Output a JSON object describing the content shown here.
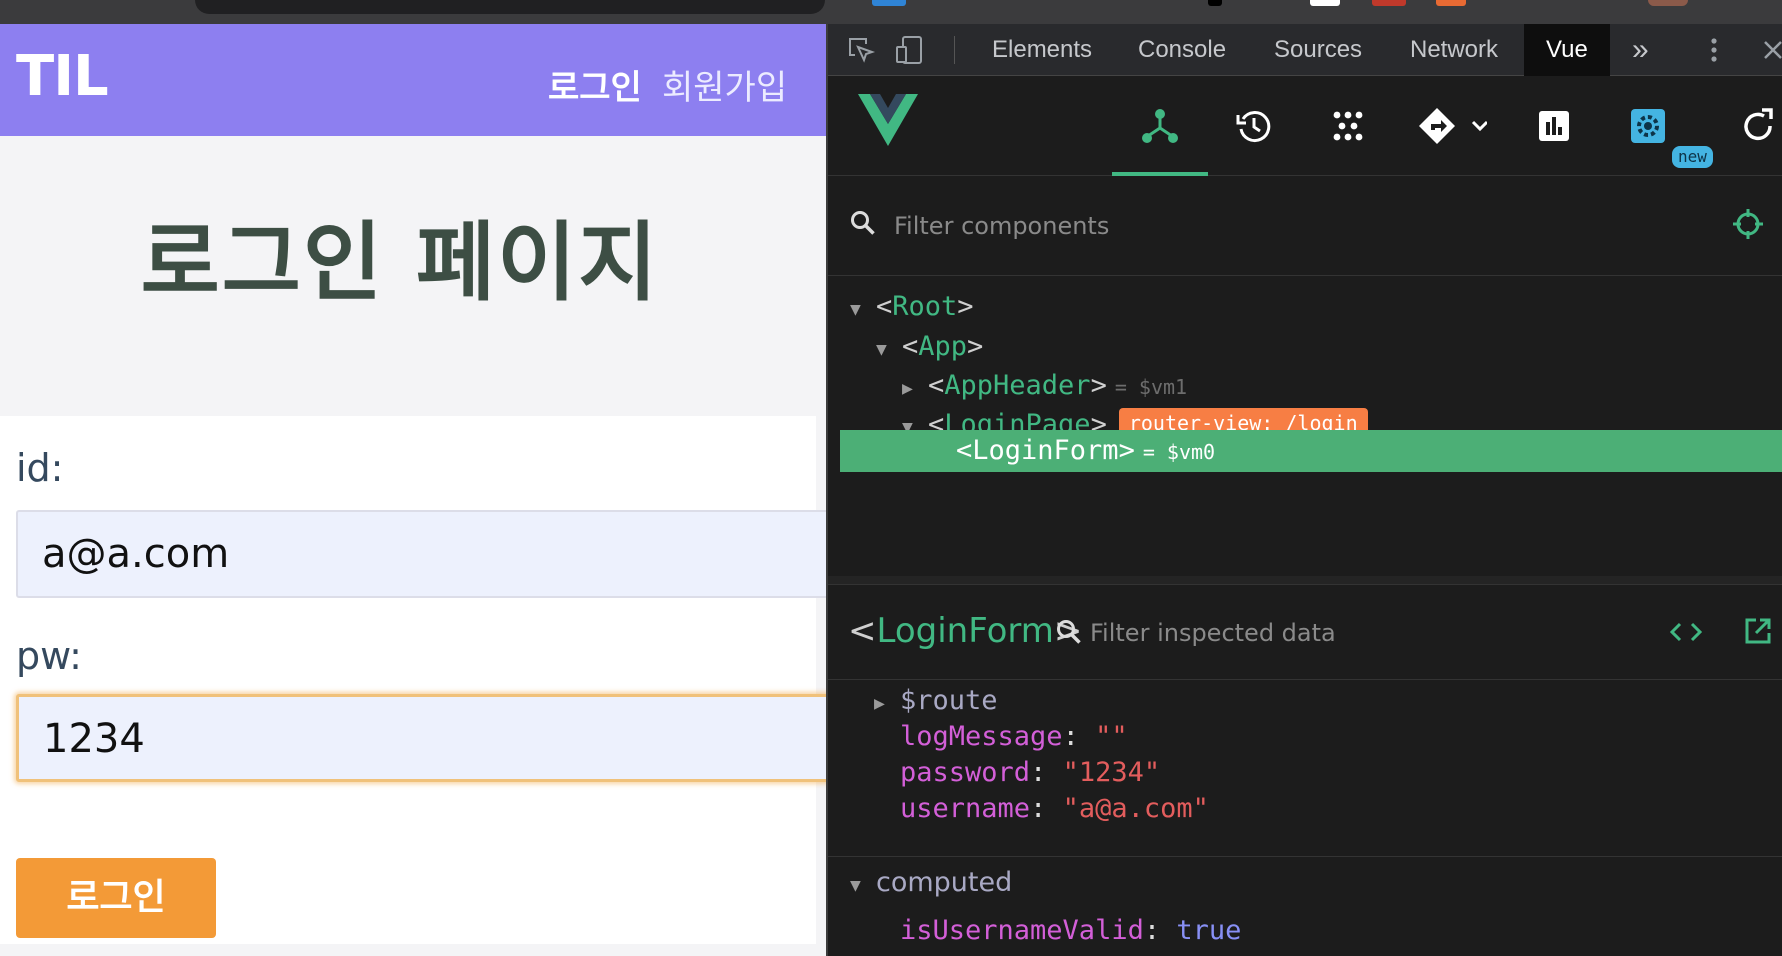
{
  "app": {
    "logo": "TIL",
    "nav": {
      "login": "로그인",
      "signup": "회원가입"
    },
    "page_title": "로그인 페이지",
    "form": {
      "id_label": "id:",
      "id_value": "a@a.com",
      "pw_label": "pw:",
      "pw_value": "1234",
      "submit_label": "로그인"
    }
  },
  "devtools": {
    "tabs": [
      "Elements",
      "Console",
      "Sources",
      "Network",
      "Vue"
    ],
    "active_tab": "Vue",
    "more_tabs": "»",
    "toolbar_badge": "new",
    "filter_placeholder": "Filter components",
    "tree": {
      "root": "Root",
      "app": "App",
      "app_header": "AppHeader",
      "app_header_ref": "= $vm1",
      "login_page": "LoginPage",
      "router_badge": "router-view: /login",
      "login_form": "LoginForm",
      "login_form_ref": "= $vm0"
    },
    "inspector": {
      "component": "LoginForm",
      "filter_placeholder": "Filter inspected data",
      "data": {
        "route": "$route",
        "log_key": "logMessage",
        "log_val": "\"\"",
        "pw_key": "password",
        "pw_val": "\"1234\"",
        "user_key": "username",
        "user_val": "\"a@a.com\""
      },
      "computed_label": "computed",
      "computed": {
        "key": "isUsernameValid",
        "val": "true"
      }
    },
    "colors": {
      "vue_green": "#41b883",
      "router_orange": "#f77e44",
      "selected_row": "#4caf76"
    }
  }
}
